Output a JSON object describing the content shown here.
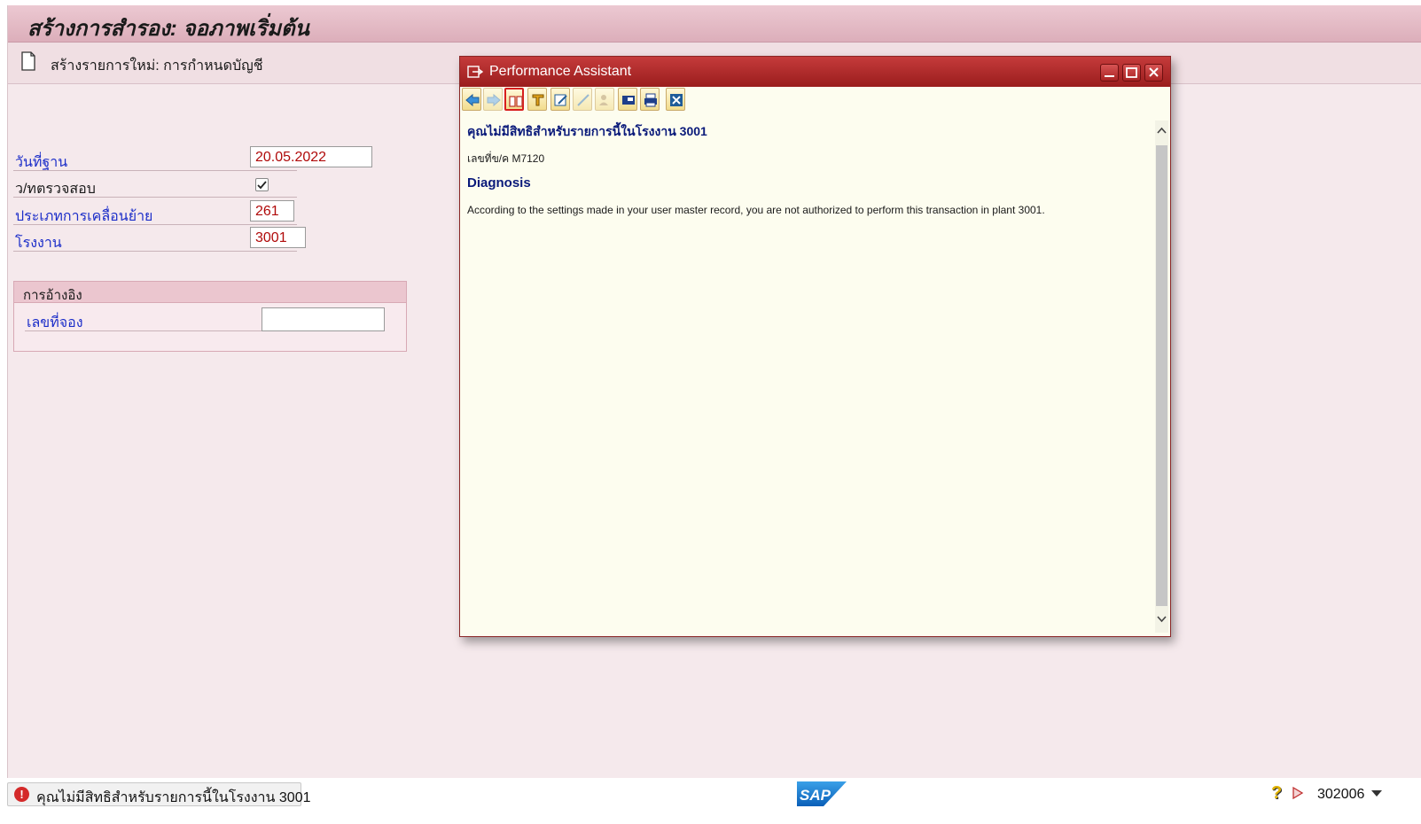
{
  "screen": {
    "title": "สร้างการสำรอง: จอภาพเริ่มต้น",
    "toolbar_label": "สร้างรายการใหม่: การกำหนดบัญชี"
  },
  "form": {
    "base_date": {
      "label": "วันที่ฐาน",
      "value": "20.05.2022"
    },
    "check": {
      "label": "ว/ทตรวจสอบ",
      "checked": true
    },
    "movement_type": {
      "label": "ประเภทการเคลื่อนย้าย",
      "value": "261"
    },
    "plant": {
      "label": "โรงงาน",
      "value": "3001"
    }
  },
  "reference": {
    "group_title": "การอ้างอิง",
    "reservation": {
      "label": "เลขที่จอง",
      "value": ""
    }
  },
  "dialog": {
    "title": "Performance Assistant",
    "tools": [
      "back-icon",
      "forward-icon",
      "technical-info-icon",
      "tools-icon",
      "edit-icon",
      "link-icon",
      "user-icon",
      "display-icon",
      "print-icon",
      "close-doc-icon"
    ],
    "heading": "คุณไม่มีสิทธิสำหรับรายการนี้ในโรงงาน 3001",
    "message_no": "เลขที่ข/ค M7120",
    "section_title": "Diagnosis",
    "diagnosis_text": "According to the settings made in your user master record, you are not authorized to perform this transaction in plant 3001."
  },
  "statusbar": {
    "message": "คุณไม่มีสิทธิสำหรับรายการนี้ในโรงงาน 3001",
    "message_type": "error",
    "system_id": "302006",
    "logo": "SAP"
  },
  "colors": {
    "title_bar": "#dcaeba",
    "background": "#f5e9ec",
    "field_label": "#1c2ec9",
    "field_value": "#b00a0a",
    "dialog_title": "#9a1d1d",
    "dialog_heading": "#0a1a7a"
  }
}
